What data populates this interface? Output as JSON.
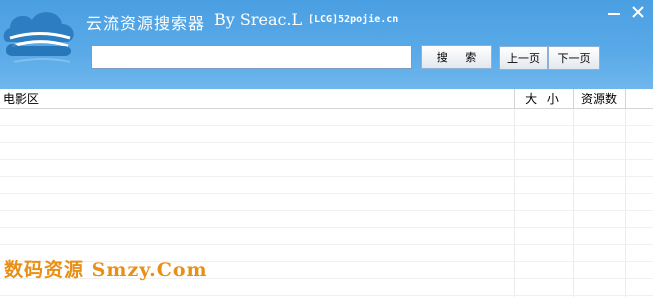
{
  "header": {
    "title": "云流资源搜索器",
    "author": "By Sreac.L",
    "site": "[LCG]52pojie.cn"
  },
  "search": {
    "value": "",
    "placeholder": "",
    "button_label": "搜 索"
  },
  "pager": {
    "prev_label": "上一页",
    "next_label": "下一页"
  },
  "table": {
    "columns": [
      "电影区",
      "大 小",
      "资源数"
    ],
    "rows": []
  },
  "watermark": "数码资源 Smzy.Com",
  "colors": {
    "header_top": "#4a9fe2",
    "header_bottom": "#6fb6ec",
    "watermark": "#e88f16"
  }
}
